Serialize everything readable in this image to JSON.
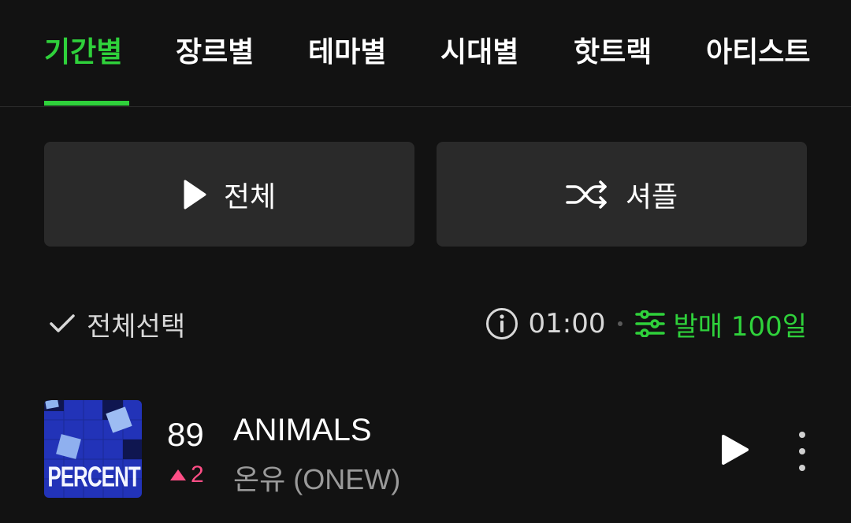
{
  "tabs": [
    {
      "label": "기간별",
      "active": true
    },
    {
      "label": "장르별",
      "active": false
    },
    {
      "label": "테마별",
      "active": false
    },
    {
      "label": "시대별",
      "active": false
    },
    {
      "label": "핫트랙",
      "active": false
    },
    {
      "label": "아티스트",
      "active": false
    }
  ],
  "actions": {
    "play_all_label": "전체",
    "shuffle_label": "셔플"
  },
  "list_header": {
    "select_all_label": "전체선택",
    "time": "01:00",
    "filter_label": "발매 100일"
  },
  "tracks": [
    {
      "rank": "89",
      "change": "2",
      "change_direction": "up",
      "title": "ANIMALS",
      "artist": "온유 (ONEW)",
      "album_art_text": "PERCENT"
    }
  ],
  "colors": {
    "accent": "#2fd13b",
    "background": "#121212",
    "button_bg": "#2a2a2a",
    "rank_up": "#ff4e86"
  }
}
